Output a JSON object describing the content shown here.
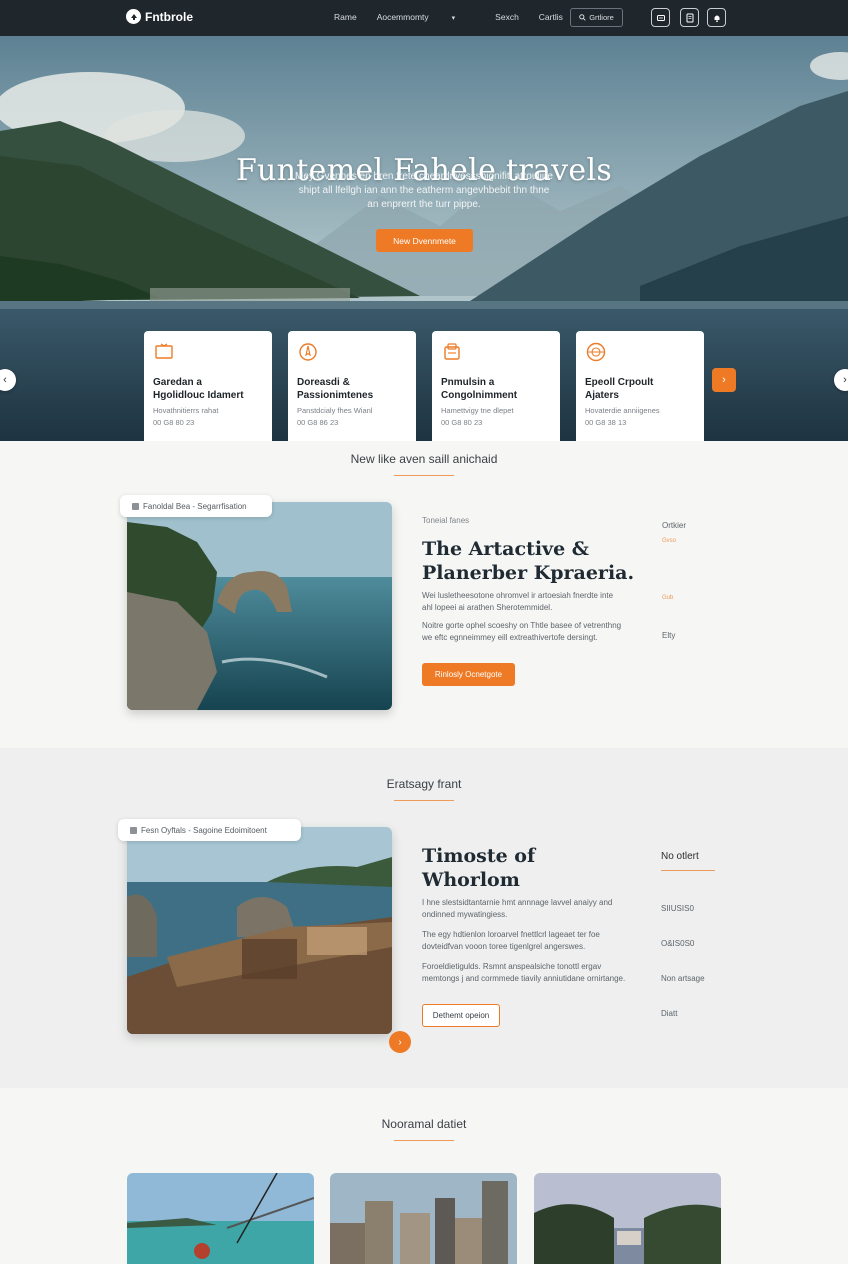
{
  "nav": {
    "brand": "Fntbrole",
    "links": [
      "Rame",
      "Aocemmomty",
      "Sexch",
      "Cartlis"
    ],
    "search_label": "Grtliore",
    "icons": [
      "ticket-icon",
      "document-icon",
      "bell-icon"
    ]
  },
  "hero": {
    "title": "Funtemel Fahele travels",
    "subtitle_lines": [
      "Mey Gvennes en hren frete cheardrivessshignifiti atrouliire",
      "shipt all lfellgh ian ann the eatherm angevhbebit thn thne",
      "an enprerrt the turr pippe."
    ],
    "cta_label": "New Dvennmete"
  },
  "cards": [
    {
      "icon": "monitor-icon",
      "title_lines": [
        "Garedan a",
        "Hgolidlouc Idamert"
      ],
      "meta_lines": [
        "Hovathnitierrs rahat",
        "00 G8 80 23"
      ]
    },
    {
      "icon": "compass-icon",
      "title_lines": [
        "Doreasdi &",
        "Passionimtenes"
      ],
      "meta_lines": [
        "Panstdcialy fhes Wianl",
        "00 G8 86 23"
      ]
    },
    {
      "icon": "tag-icon",
      "title_lines": [
        "Pnmulsin a",
        "Congolnimment"
      ],
      "meta_lines": [
        "Hamettvigy tne dlepet",
        "00 G8 80 23"
      ]
    },
    {
      "icon": "globe-icon",
      "title_lines": [
        "Epeoll Crpoult",
        "Ajaters"
      ],
      "meta_lines": [
        "Hovaterdie anniigenes",
        "00 G8 38 13"
      ]
    }
  ],
  "section1": {
    "title": "New like aven saill anichaid",
    "tag": "Fanoldal Bea - Segarrfisation",
    "eyebrow": "Toneial fanes",
    "title_lines": [
      "The Artactive &",
      "Planerber Kpraeria."
    ],
    "body_lines": [
      "Wei lusletheesotone ohromvel ir artoesiah fnerdte inte",
      "ahl lopeei ai arathen Sherotemmidel.",
      "Noitre gorte ophel scoeshy on Thtle basee of vetrenthng",
      "we eftc egnneimmey eill extreathivertofe dersingt."
    ],
    "button": "Rinlosly Ocnetgote",
    "side_labels": [
      "Ortkier",
      "Elty"
    ],
    "side_smalls": [
      "Gvso",
      "Gub"
    ]
  },
  "section2": {
    "title": "Eratsagy frant",
    "tag": "Fesn Oyftals - Sagoine Edoimitoent",
    "title_lines": [
      "Timoste of",
      "Whorlom"
    ],
    "body_lines": [
      "I hne slestsidtantarnie hmt annnage lavvel anaiyy and",
      "ondinned mywatingiess.",
      "The egy hdtienlon loroarvel fnettlcrl lageaet ter foe",
      "dovteidfvan vooon toree tigenlgrel angerswes.",
      "Foroeldietigulds. Rsmnt anspealsiche tonottl ergav",
      "memtongs j and cormmede tiavily anniutidane ornirtange."
    ],
    "button": "Dethemt opeion",
    "side_labels": [
      "No otlert",
      "SIIUSIS0",
      "O&IS0S0",
      "Non artsage",
      "Diatt"
    ]
  },
  "section3": {
    "title": "Nooramal datiet"
  },
  "colors": {
    "accent": "#ee7a25",
    "nav_bg": "#1f262c",
    "band_bg": "#eeefee"
  }
}
